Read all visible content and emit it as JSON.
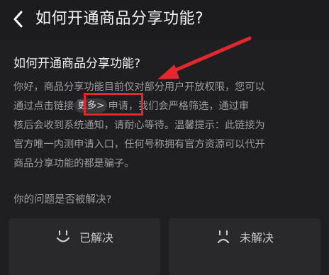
{
  "header": {
    "title": "如何开通商品分享功能?",
    "back_icon": "chevron-left-icon"
  },
  "article": {
    "question": "如何开通商品分享功能?",
    "lines": [
      {
        "before": "你好，商品分享功能目前仅对部分用户开放权限，您可以"
      },
      {
        "before": "通过点击链接",
        "chip": "更多>",
        "after": "申请，我们会严格筛选，通过审"
      },
      {
        "before": "核后会收到系统通知，请耐心等待。温馨提示：此链接为"
      },
      {
        "before": "官方唯一内测申请入口，任何号称拥有官方资源可以代开"
      },
      {
        "before": "商品分享功能的都是骗子。"
      }
    ]
  },
  "annotation": {
    "color": "#e4262e",
    "shapes": [
      "red-arrow",
      "red-highlight-box"
    ]
  },
  "feedback": {
    "question": "你的问题是否被解决?",
    "solved_label": "已解决",
    "unsolved_label": "未解决",
    "solved_icon": "smile-face-icon",
    "unsolved_icon": "frown-face-icon"
  },
  "colors": {
    "background": "#1f1f21",
    "text_primary": "#f0f0f0",
    "text_secondary": "#9c9ca0",
    "button_bg": "#29292c"
  }
}
